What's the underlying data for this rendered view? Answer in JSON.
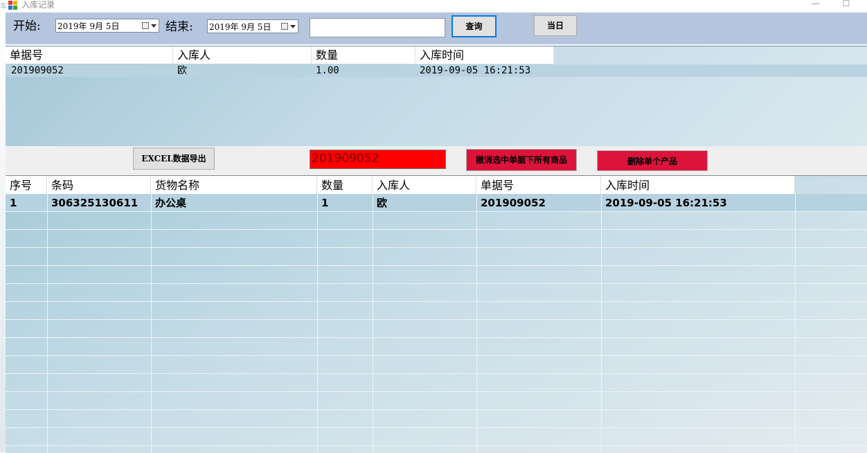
{
  "window": {
    "title": "入库记录",
    "minimize_glyph": "—",
    "maximize_glyph": "☐",
    "edge_char": "车"
  },
  "filters": {
    "start_label": "开始:",
    "start_date": "2019年 9月 5日",
    "end_label": "结束:",
    "end_date": "2019年 9月 5日",
    "search_value": "",
    "query_label": "查询",
    "today_label": "当日"
  },
  "orders_table": {
    "columns": [
      "单据号",
      "入库人",
      "数量",
      "入库时间"
    ],
    "rows": [
      [
        "201909052",
        "欧",
        "1.00",
        "2019-09-05 16:21:53"
      ]
    ]
  },
  "actions": {
    "excel_label": "EXCEL数据导出",
    "selected_order": "201909052",
    "cancel_all_label": "撤消选中单据下所有商品",
    "delete_one_label": "删除单个产品"
  },
  "items_table": {
    "columns": [
      "序号",
      "条码",
      "货物名称",
      "数量",
      "入库人",
      "单据号",
      "入库时间"
    ],
    "rows": [
      [
        "1",
        "306325130611",
        "办公桌",
        "1",
        "欧",
        "201909052",
        "2019-09-05 16:21:53"
      ]
    ]
  },
  "colors": {
    "toolbar_bg": "#b5c5de",
    "highlight_red": "#ff0000",
    "button_red": "#dc143c",
    "focus_blue": "#0a78d7"
  }
}
